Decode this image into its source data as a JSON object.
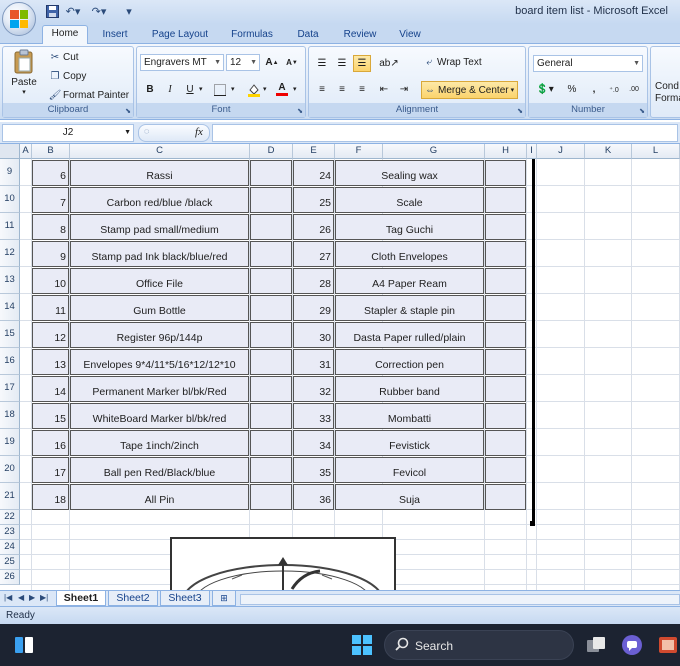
{
  "window": {
    "title": "board item list - Microsoft Excel"
  },
  "qat": {
    "undo_icon": "undo-icon",
    "redo_icon": "redo-icon",
    "save_icon": "save-icon"
  },
  "tabs": [
    "Home",
    "Insert",
    "Page Layout",
    "Formulas",
    "Data",
    "Review",
    "View"
  ],
  "ribbon": {
    "clipboard": {
      "label": "Clipboard",
      "paste": "Paste",
      "cut": "Cut",
      "copy": "Copy",
      "format_painter": "Format Painter"
    },
    "font": {
      "label": "Font",
      "font_name": "Engravers MT",
      "font_size": "12",
      "bold": "B",
      "italic": "I",
      "underline": "U"
    },
    "alignment": {
      "label": "Alignment",
      "wrap_text": "Wrap Text",
      "merge_center": "Merge & Center"
    },
    "number": {
      "label": "Number",
      "format": "General",
      "percent": "%",
      "comma": ","
    },
    "styles": {
      "cond_label_1": "Cond",
      "cond_label_2": "Forma"
    }
  },
  "formula_bar": {
    "name_box": "J2",
    "fx": "fx",
    "value": ""
  },
  "columns": [
    "A",
    "B",
    "C",
    "D",
    "E",
    "F",
    "G",
    "H",
    "I",
    "J",
    "K",
    "L",
    "M"
  ],
  "rows": [
    "9",
    "10",
    "11",
    "12",
    "13",
    "14",
    "15",
    "16",
    "17",
    "18",
    "19",
    "20",
    "21",
    "22",
    "23",
    "24",
    "25",
    "26"
  ],
  "table": [
    {
      "n1": "6",
      "item1": "Rassi",
      "n2": "24",
      "item2": "Sealing wax"
    },
    {
      "n1": "7",
      "item1": "Carbon red/blue /black",
      "n2": "25",
      "item2": "Scale"
    },
    {
      "n1": "8",
      "item1": "Stamp pad small/medium",
      "n2": "26",
      "item2": "Tag Guchi"
    },
    {
      "n1": "9",
      "item1": "Stamp pad Ink black/blue/red",
      "n2": "27",
      "item2": "Cloth Envelopes"
    },
    {
      "n1": "10",
      "item1": "Office File",
      "n2": "28",
      "item2": "A4 Paper Ream"
    },
    {
      "n1": "11",
      "item1": "Gum Bottle",
      "n2": "29",
      "item2": "Stapler & staple pin"
    },
    {
      "n1": "12",
      "item1": "Register 96p/144p",
      "n2": "30",
      "item2": "Dasta Paper rulled/plain"
    },
    {
      "n1": "13",
      "item1": "Envelopes 9*4/11*5/16*12/12*10",
      "n2": "31",
      "item2": "Correction pen"
    },
    {
      "n1": "14",
      "item1": "Permanent Marker bl/bk/Red",
      "n2": "32",
      "item2": "Rubber band"
    },
    {
      "n1": "15",
      "item1": "WhiteBoard Marker bl/bk/red",
      "n2": "33",
      "item2": "Mombatti"
    },
    {
      "n1": "16",
      "item1": "Tape 1inch/2inch",
      "n2": "34",
      "item2": "Fevistick"
    },
    {
      "n1": "17",
      "item1": "Ball pen Red/Black/blue",
      "n2": "35",
      "item2": "Fevicol"
    },
    {
      "n1": "18",
      "item1": "All Pin",
      "n2": "36",
      "item2": "Suja"
    }
  ],
  "sheets": [
    "Sheet1",
    "Sheet2",
    "Sheet3"
  ],
  "status": {
    "text": "Ready"
  },
  "taskbar": {
    "search_label": "Search"
  }
}
